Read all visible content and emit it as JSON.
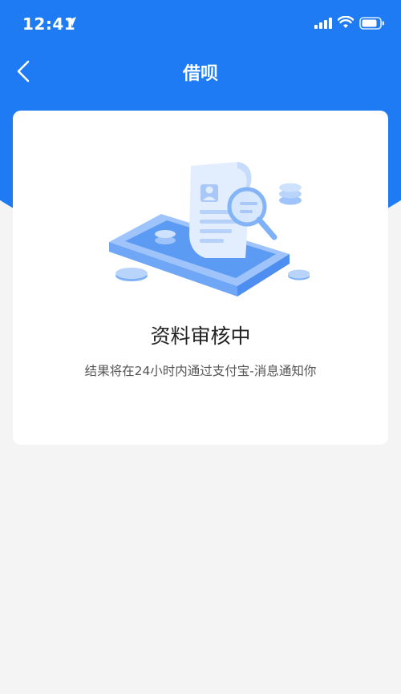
{
  "status_bar": {
    "time": "12:41",
    "icons": [
      "location-arrow-icon",
      "cellular-signal-icon",
      "wifi-icon",
      "battery-icon"
    ]
  },
  "nav": {
    "title": "借呗",
    "back_icon": "chevron-left-icon"
  },
  "review": {
    "title": "资料审核中",
    "subtitle": "结果将在24小时内通过支付宝-消息通知你"
  },
  "colors": {
    "header_blue": "#1f7bf4",
    "page_background": "#f4f4f4",
    "card_background": "#ffffff"
  }
}
